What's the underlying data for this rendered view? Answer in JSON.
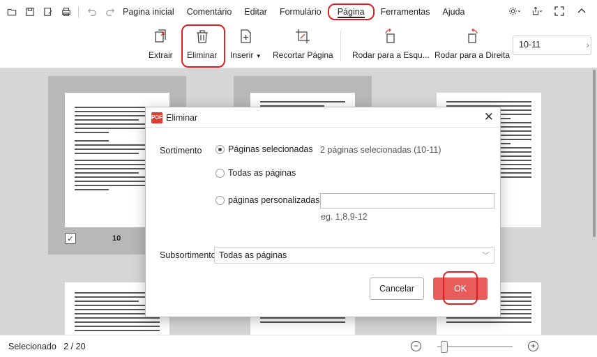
{
  "menubar": {
    "items": [
      "Pagina inicial",
      "Comentário",
      "Editar",
      "Formulário",
      "Página",
      "Ferramentas",
      "Ajuda"
    ],
    "active": "Página"
  },
  "ribbon": {
    "extrair": "Extrair",
    "eliminar": "Eliminar",
    "inserir": "Inserir",
    "recortar": "Recortar Página",
    "rodar_esq": "Rodar para a Esqu...",
    "rodar_dir": "Rodar para a Direita",
    "page_range": "10-11"
  },
  "thumbnails": {
    "page_number": "10"
  },
  "dialog": {
    "title": "Eliminar",
    "sortimento_label": "Sortimento",
    "opt_selected": "Páginas selecionadas",
    "selected_info": "2  páginas selecionadas (10-11)",
    "opt_all": "Todas as páginas",
    "opt_custom": "páginas personalizadas",
    "custom_value": "",
    "custom_hint": "eg. 1,8,9-12",
    "subsortimento_label": "Subsortimento",
    "subsortimento_value": "Todas as páginas",
    "cancel": "Cancelar",
    "ok": "OK"
  },
  "statusbar": {
    "label": "Selecionado",
    "current": "2",
    "sep": "/",
    "total": "20"
  },
  "colors": {
    "highlight": "#e02020",
    "ok_button": "#e85c5c"
  }
}
